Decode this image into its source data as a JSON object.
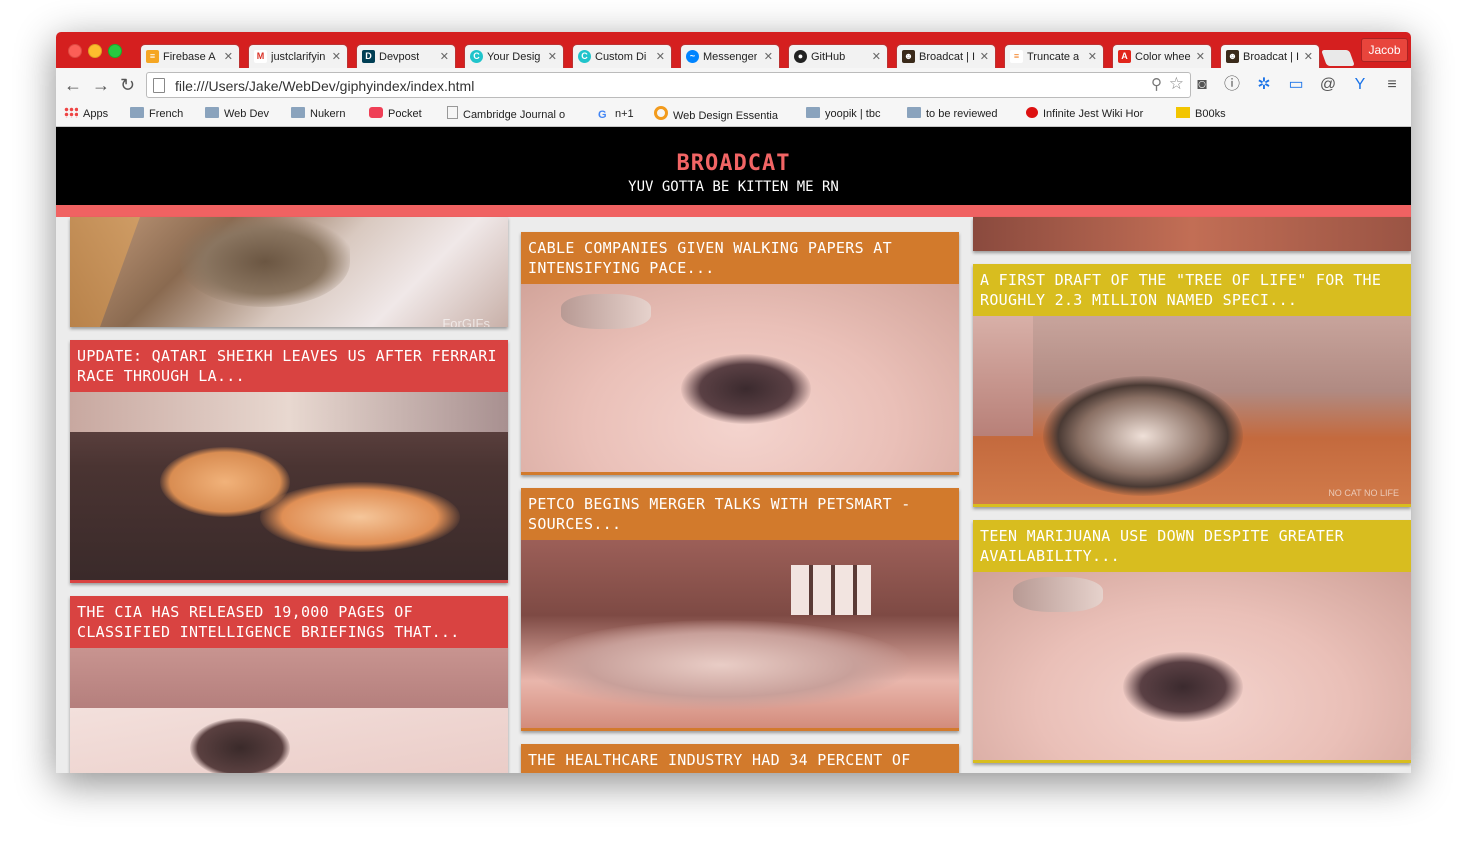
{
  "browser": {
    "tabs": [
      {
        "label": "Firebase A",
        "icon": "firebase-icon",
        "color": "#f5a623"
      },
      {
        "label": "justclarifyin",
        "icon": "gmail-icon",
        "color": "#d93025"
      },
      {
        "label": "Devpost",
        "icon": "devpost-icon",
        "color": "#003e54"
      },
      {
        "label": "Your Desig",
        "icon": "canva-icon",
        "color": "#20c4cb"
      },
      {
        "label": "Custom Di",
        "icon": "canva-icon",
        "color": "#20c4cb"
      },
      {
        "label": "Messenger",
        "icon": "messenger-icon",
        "color": "#0084ff"
      },
      {
        "label": "GitHub",
        "icon": "github-icon",
        "color": "#222222"
      },
      {
        "label": "Broadcat | I",
        "icon": "broadcat-icon",
        "color": "#3a2a1a"
      },
      {
        "label": "Truncate a",
        "icon": "stackoverflow-icon",
        "color": "#f48024"
      },
      {
        "label": "Color whee",
        "icon": "adobe-icon",
        "color": "#e1251b"
      },
      {
        "label": "Broadcat | I",
        "icon": "broadcat-icon",
        "color": "#3a2a1a"
      }
    ],
    "profile": "Jacob",
    "url": "file:///Users/Jake/WebDev/giphyindex/index.html",
    "bookmarks": [
      {
        "label": "Apps"
      },
      {
        "label": "French"
      },
      {
        "label": "Web Dev"
      },
      {
        "label": "Nukern"
      },
      {
        "label": "Pocket"
      },
      {
        "label": "Cambridge Journal o"
      },
      {
        "label": "n+1"
      },
      {
        "label": "Web Design Essentia"
      },
      {
        "label": "yoopik | tbc"
      },
      {
        "label": "to be reviewed"
      },
      {
        "label": "Infinite Jest Wiki Hor"
      },
      {
        "label": "B00ks"
      }
    ]
  },
  "site": {
    "title": "BROADCAT",
    "subtitle": "YUV GOTTA BE KITTEN ME RN",
    "accent": "#f06262"
  },
  "cards": {
    "c1": {
      "caption": "",
      "watermark": "ForGIFs"
    },
    "c2": {
      "caption": "UPDATE: QATARI SHEIKH LEAVES US AFTER FERRARI RACE THROUGH LA..."
    },
    "c3": {
      "caption": "THE CIA HAS RELEASED 19,000 PAGES OF CLASSIFIED INTELLIGENCE BRIEFINGS THAT..."
    },
    "c4": {
      "caption": "CABLE COMPANIES GIVEN WALKING PAPERS AT INTENSIFYING PACE..."
    },
    "c5": {
      "caption": "PETCO BEGINS MERGER TALKS WITH PETSMART - SOURCES..."
    },
    "c6": {
      "caption": "THE HEALTHCARE INDUSTRY HAD 34 PERCENT OF"
    },
    "c7": {
      "caption": ""
    },
    "c8": {
      "caption": "A FIRST DRAFT OF THE \"TREE OF LIFE\" FOR THE ROUGHLY 2.3 MILLION NAMED SPECI...",
      "watermark": "NO CAT NO LIFE"
    },
    "c9": {
      "caption": "TEEN MARIJUANA USE DOWN DESPITE GREATER AVAILABILITY..."
    }
  },
  "colors": {
    "red": "#d94341",
    "orange": "#d27a2c",
    "yellow": "#d8bd1f"
  }
}
